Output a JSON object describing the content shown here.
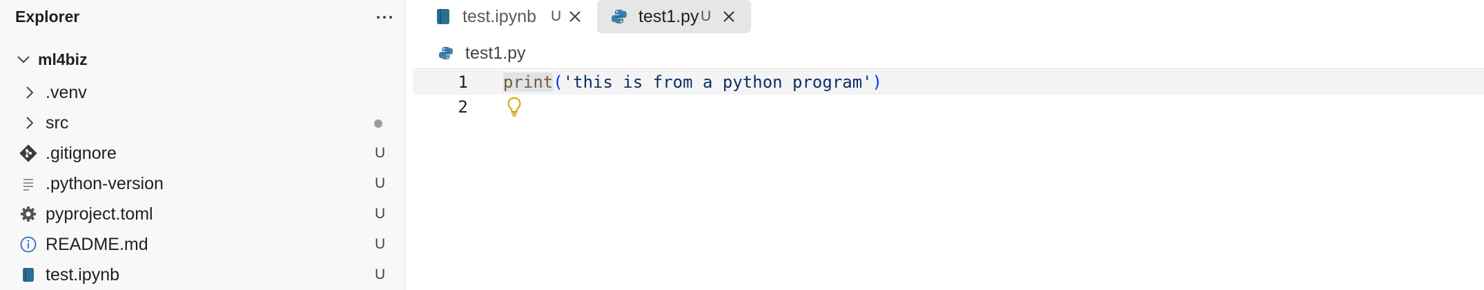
{
  "sidebar": {
    "title": "Explorer",
    "more_icon": "ellipsis-icon",
    "folder": {
      "name": "ml4biz",
      "expanded": true
    },
    "items": [
      {
        "label": ".venv",
        "kind": "folder",
        "status": ""
      },
      {
        "label": "src",
        "kind": "folder",
        "status": "modified-dot"
      },
      {
        "label": ".gitignore",
        "kind": "git-file",
        "status": "U"
      },
      {
        "label": ".python-version",
        "kind": "text-file",
        "status": "U"
      },
      {
        "label": "pyproject.toml",
        "kind": "settings-file",
        "status": "U"
      },
      {
        "label": "README.md",
        "kind": "info-file",
        "status": "U"
      },
      {
        "label": "test.ipynb",
        "kind": "notebook-file",
        "status": "U"
      }
    ]
  },
  "tabs": [
    {
      "label": "test.ipynb",
      "status": "U",
      "icon": "notebook-icon",
      "active": false
    },
    {
      "label": "test1.py",
      "status": "U",
      "icon": "python-icon",
      "active": true
    }
  ],
  "breadcrumb": {
    "label": "test1.py",
    "icon": "python-icon"
  },
  "editor": {
    "lines": [
      {
        "number": "1",
        "fn": "print",
        "open": "(",
        "string": "'this is from a python program'",
        "close": ")"
      },
      {
        "number": "2"
      }
    ],
    "lightbulb_icon": "lightbulb-icon"
  },
  "colors": {
    "sidebar_bg": "#f8f8f8",
    "active_tab_bg": "#e6e6e6",
    "notebook_icon": "#2a6f8f",
    "python_icon": "#3b7bbf",
    "function_color": "#795e26",
    "string_color": "#0a3069",
    "bulb_color": "#d4a400"
  }
}
